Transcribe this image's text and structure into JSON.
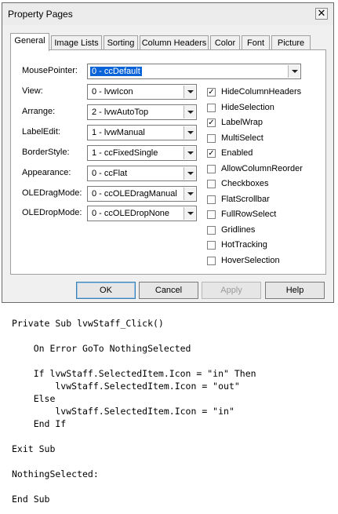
{
  "dialog": {
    "title": "Property Pages",
    "close_label": "✕"
  },
  "tabs": [
    "General",
    "Image Lists",
    "Sorting",
    "Column Headers",
    "Color",
    "Font",
    "Picture"
  ],
  "fields": {
    "mousepointer": {
      "label": "MousePointer:",
      "value": "0 - ccDefault"
    },
    "view": {
      "label": "View:",
      "value": "0 - lvwIcon"
    },
    "arrange": {
      "label": "Arrange:",
      "value": "2 - lvwAutoTop"
    },
    "labeledit": {
      "label": "LabelEdit:",
      "value": "1 - lvwManual"
    },
    "borderstyle": {
      "label": "BorderStyle:",
      "value": "1 - ccFixedSingle"
    },
    "appearance": {
      "label": "Appearance:",
      "value": "0 - ccFlat"
    },
    "oledragmode": {
      "label": "OLEDragMode:",
      "value": "0 - ccOLEDragManual"
    },
    "oledropmode": {
      "label": "OLEDropMode:",
      "value": "0 - ccOLEDropNone"
    }
  },
  "checkboxes": [
    {
      "label": "HideColumnHeaders",
      "checked": true
    },
    {
      "label": "HideSelection",
      "checked": false
    },
    {
      "label": "LabelWrap",
      "checked": true
    },
    {
      "label": "MultiSelect",
      "checked": false
    },
    {
      "label": "Enabled",
      "checked": true
    },
    {
      "label": "AllowColumnReorder",
      "checked": false
    },
    {
      "label": "Checkboxes",
      "checked": false
    },
    {
      "label": "FlatScrollbar",
      "checked": false
    },
    {
      "label": "FullRowSelect",
      "checked": false
    },
    {
      "label": "Gridlines",
      "checked": false
    },
    {
      "label": "HotTracking",
      "checked": false
    },
    {
      "label": "HoverSelection",
      "checked": false
    }
  ],
  "buttons": {
    "ok": "OK",
    "cancel": "Cancel",
    "apply": "Apply",
    "help": "Help"
  },
  "code": [
    "Private Sub lvwStaff_Click()",
    "",
    "    On Error GoTo NothingSelected",
    "",
    "    If lvwStaff.SelectedItem.Icon = \"in\" Then",
    "        lvwStaff.SelectedItem.Icon = \"out\"",
    "    Else",
    "        lvwStaff.SelectedItem.Icon = \"in\"",
    "    End If",
    "",
    "Exit Sub",
    "",
    "NothingSelected:",
    "",
    "End Sub"
  ],
  "check_mark": "✓"
}
